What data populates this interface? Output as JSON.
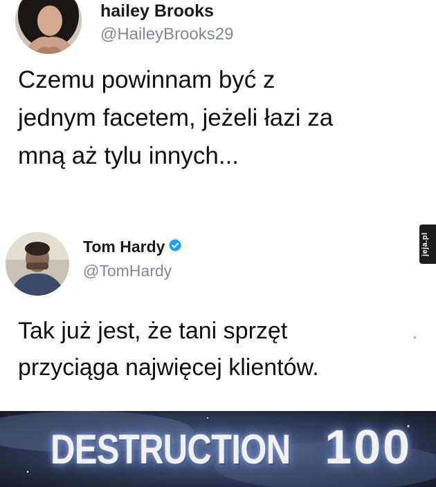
{
  "tweets": [
    {
      "name": "hailey Brooks",
      "handle": "@HaileyBrooks29",
      "verified": false,
      "text": "Czemu powinnam być z\njednym facetem, jeżeli łazi za\nmną aż tylu innych..."
    },
    {
      "name": "Tom Hardy",
      "handle": "@TomHardy",
      "verified": true,
      "text": "Tak już jest, że tani sprzęt\nprzyciąga najwięcej klientów."
    }
  ],
  "watermark": {
    "text": "jeja.pl"
  },
  "banner": {
    "label": "DESTRUCTION",
    "value": "100"
  },
  "colors": {
    "verified": "#1da1f2",
    "handle": "#7b8a96",
    "banner_bg": "#232a3c"
  }
}
